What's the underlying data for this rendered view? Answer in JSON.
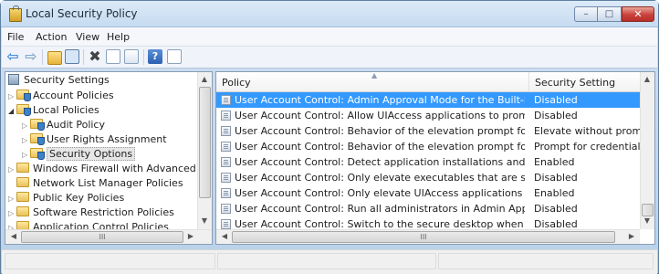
{
  "window": {
    "title": "Local Security Policy"
  },
  "window_controls": {
    "minimize": "–",
    "maximize": "□",
    "close": "✕"
  },
  "menu": [
    "File",
    "Action",
    "View",
    "Help"
  ],
  "toolbar": {
    "icons": [
      "back-arrow-icon",
      "forward-arrow-icon",
      "up-folder-icon",
      "show-tree-icon",
      "delete-icon",
      "properties-icon",
      "export-list-icon",
      "help-icon",
      "view-icon"
    ],
    "glyphs": {
      "back": "⇦",
      "forward": "⇨",
      "delete": "✖",
      "help": "?"
    }
  },
  "tree": {
    "root": "Security Settings",
    "items": [
      {
        "label": "Account Policies",
        "level": 1,
        "expanded": false
      },
      {
        "label": "Local Policies",
        "level": 1,
        "expanded": true
      },
      {
        "label": "Audit Policy",
        "level": 2,
        "expanded": false
      },
      {
        "label": "User Rights Assignment",
        "level": 2,
        "expanded": false
      },
      {
        "label": "Security Options",
        "level": 2,
        "expanded": false,
        "selected": true
      },
      {
        "label": "Windows Firewall with Advanced S",
        "level": 1,
        "expanded": false
      },
      {
        "label": "Network List Manager Policies",
        "level": 1,
        "expanded": false
      },
      {
        "label": "Public Key Policies",
        "level": 1,
        "expanded": false
      },
      {
        "label": "Software Restriction Policies",
        "level": 1,
        "expanded": false
      },
      {
        "label": "Application Control Policies",
        "level": 1,
        "expanded": false
      }
    ],
    "hscroll_label": "III"
  },
  "list": {
    "columns": {
      "policy": "Policy",
      "setting": "Security Setting"
    },
    "rows": [
      {
        "policy": "User Account Control: Admin Approval Mode for the Built-in Ad...",
        "setting": "Disabled",
        "selected": true
      },
      {
        "policy": "User Account Control: Allow UIAccess applications to prompt for ...",
        "setting": "Disabled"
      },
      {
        "policy": "User Account Control: Behavior of the elevation prompt for admi...",
        "setting": "Elevate without prompti..."
      },
      {
        "policy": "User Account Control: Behavior of the elevation prompt for stand...",
        "setting": "Prompt for credentials"
      },
      {
        "policy": "User Account Control: Detect application installations and promp...",
        "setting": "Enabled"
      },
      {
        "policy": "User Account Control: Only elevate executables that are signed an...",
        "setting": "Disabled"
      },
      {
        "policy": "User Account Control: Only elevate UIAccess applications that are...",
        "setting": "Enabled"
      },
      {
        "policy": "User Account Control: Run all administrators in Admin Approval ...",
        "setting": "Disabled"
      },
      {
        "policy": "User Account Control: Switch to the secure desktop when prompt...",
        "setting": "Disabled"
      }
    ],
    "hscroll_label": "III"
  },
  "scroll": {
    "up": "▲",
    "down": "▼",
    "left": "◀",
    "right": "▶"
  },
  "colors": {
    "selection": "#3399ff",
    "title_bg": "#c6dbf1",
    "close_button": "#c8413a"
  }
}
